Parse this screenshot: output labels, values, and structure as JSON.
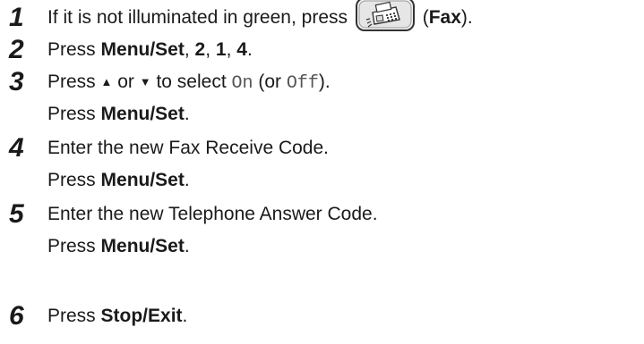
{
  "steps": [
    {
      "number": "1",
      "text_before": "If it is not illuminated in green, press",
      "open_paren": "(",
      "bold": "Fax",
      "close_paren": ")."
    },
    {
      "number": "2",
      "prefix": "Press ",
      "bold": "Menu/Set",
      "sep1": ", ",
      "b1": "2",
      "sep2": ", ",
      "b2": "1",
      "sep3": ", ",
      "b3": "4",
      "end": "."
    },
    {
      "number": "3",
      "prefix": "Press ",
      "up": "▲",
      "or": " or ",
      "down": "▼",
      "mid": " to select ",
      "opt1": "On",
      "paren_open": " (or ",
      "opt2": "Off",
      "paren_close": ").",
      "line2_prefix": "Press ",
      "line2_bold": "Menu/Set",
      "line2_end": "."
    },
    {
      "number": "4",
      "text": "Enter the new Fax Receive Code.",
      "line2_prefix": "Press ",
      "line2_bold": "Menu/Set",
      "line2_end": "."
    },
    {
      "number": "5",
      "text": "Enter the new Telephone Answer Code.",
      "line2_prefix": "Press ",
      "line2_bold": "Menu/Set",
      "line2_end": "."
    },
    {
      "number": "6",
      "prefix": "Press ",
      "bold": "Stop/Exit",
      "end": "."
    }
  ],
  "icons": {
    "fax_button": "fax-machine-icon"
  }
}
